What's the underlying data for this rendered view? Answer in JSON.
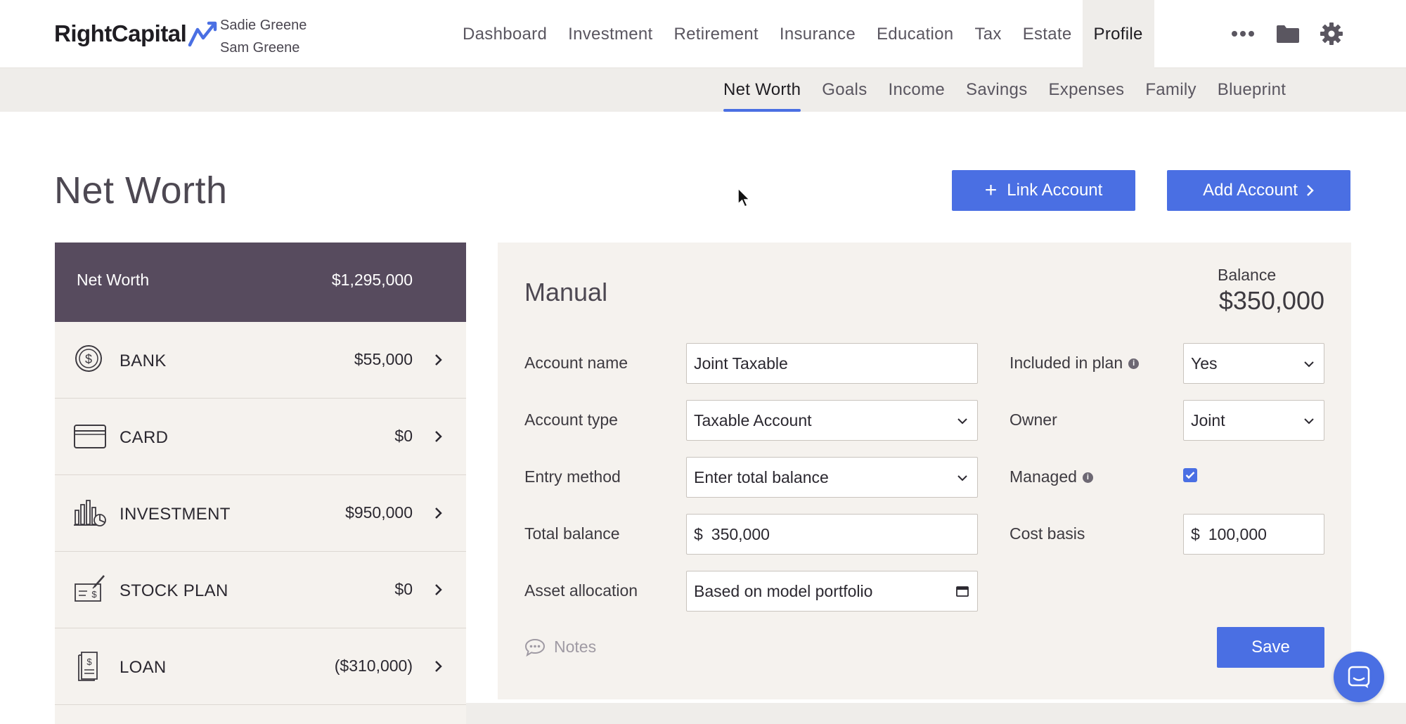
{
  "header": {
    "logo_text": "RightCapital",
    "clients": [
      "Sadie Greene",
      "Sam Greene"
    ],
    "nav": [
      {
        "label": "Dashboard"
      },
      {
        "label": "Investment"
      },
      {
        "label": "Retirement"
      },
      {
        "label": "Insurance"
      },
      {
        "label": "Education"
      },
      {
        "label": "Tax"
      },
      {
        "label": "Estate"
      },
      {
        "label": "Profile",
        "active": true
      }
    ],
    "icons": [
      "more-icon",
      "folder-icon",
      "gear-icon"
    ]
  },
  "subnav": [
    {
      "label": "Net Worth",
      "active": true
    },
    {
      "label": "Goals"
    },
    {
      "label": "Income"
    },
    {
      "label": "Savings"
    },
    {
      "label": "Expenses"
    },
    {
      "label": "Family"
    },
    {
      "label": "Blueprint"
    }
  ],
  "page": {
    "title": "Net Worth",
    "link_account_label": "Link Account",
    "add_account_label": "Add Account"
  },
  "summary": {
    "label": "Net Worth",
    "value": "$1,295,000"
  },
  "accounts": [
    {
      "name": "BANK",
      "amount": "$55,000",
      "icon": "bank-dollar-icon"
    },
    {
      "name": "CARD",
      "amount": "$0",
      "icon": "credit-card-icon"
    },
    {
      "name": "INVESTMENT",
      "amount": "$950,000",
      "icon": "investment-chart-icon"
    },
    {
      "name": "STOCK PLAN",
      "amount": "$0",
      "icon": "stock-plan-icon"
    },
    {
      "name": "LOAN",
      "amount": "($310,000)",
      "icon": "loan-document-icon"
    }
  ],
  "panel": {
    "title": "Manual",
    "balance_label": "Balance",
    "balance_value": "$350,000",
    "fields": {
      "account_name": {
        "label": "Account name",
        "value": "Joint Taxable"
      },
      "account_type": {
        "label": "Account type",
        "value": "Taxable Account"
      },
      "entry_method": {
        "label": "Entry method",
        "value": "Enter total balance"
      },
      "total_balance": {
        "label": "Total balance",
        "currency": "$",
        "value": "350,000"
      },
      "asset_allocation": {
        "label": "Asset allocation",
        "value": "Based on model portfolio"
      },
      "included_in_plan": {
        "label": "Included in plan",
        "value": "Yes"
      },
      "owner": {
        "label": "Owner",
        "value": "Joint"
      },
      "managed": {
        "label": "Managed",
        "checked": true
      },
      "cost_basis": {
        "label": "Cost basis",
        "currency": "$",
        "value": "100,000"
      }
    },
    "notes_label": "Notes",
    "save_label": "Save"
  },
  "colors": {
    "accent": "#4a6fe3",
    "summary_bg": "#574b5e",
    "panel_bg": "#f5f2ee",
    "subnav_bg": "#efedea"
  }
}
